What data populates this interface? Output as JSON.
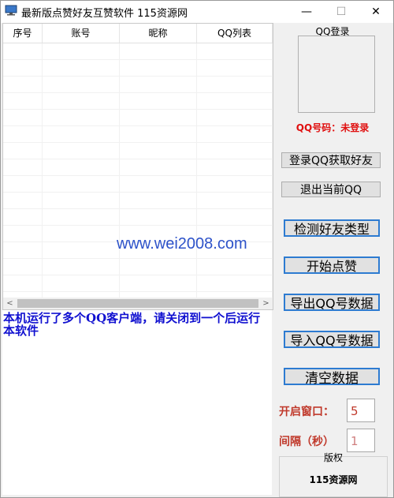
{
  "window": {
    "title": "最新版点赞好友互赞软件 115资源网",
    "minimize_glyph": "—",
    "maximize_glyph": "☐",
    "close_glyph": "✕"
  },
  "grid": {
    "columns": [
      "序号",
      "账号",
      "昵称",
      "QQ列表"
    ],
    "scroll_left": "<",
    "scroll_right": ">"
  },
  "log": {
    "message": "本机运行了多个QQ客户端，请关闭到一个后运行本软件"
  },
  "watermark": "www.wei2008.com",
  "qq_login": {
    "legend": "QQ登录",
    "status": "QQ号码：未登录"
  },
  "buttons": {
    "login": "登录QQ获取好友",
    "logout": "退出当前QQ",
    "detect": "检测好友类型",
    "start": "开始点赞",
    "export": "导出QQ号数据",
    "import": "导入QQ号数据",
    "clear": "清空数据"
  },
  "settings": {
    "window_label": "开启窗口：",
    "window_value": "5",
    "interval_label": "间隔（秒）",
    "interval_value": "1"
  },
  "copyright": {
    "legend": "版权",
    "value": "115资源网"
  },
  "colors": {
    "accent_border": "#2d7bd1",
    "error_text": "#e01010",
    "log_text": "#1010d0",
    "label_text": "#c0392b"
  }
}
